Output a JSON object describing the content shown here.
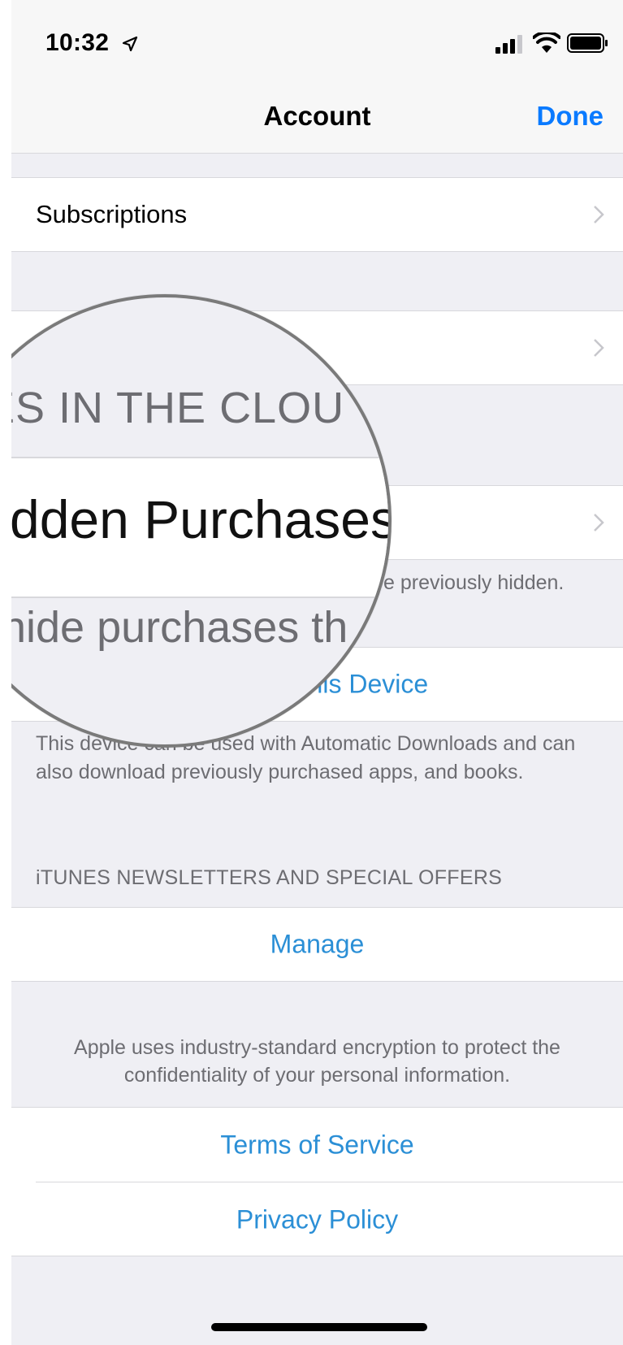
{
  "status_bar": {
    "time": "10:32"
  },
  "nav": {
    "title": "Account",
    "done_label": "Done"
  },
  "rows": {
    "subscriptions": "Subscriptions",
    "hidden_purchases_footer": "e previously hidden.",
    "this_device_link": "This Device",
    "device_footer": "This device can be used with Automatic Downloads and can also download previously purchased apps, and books.",
    "newsletters_header": "iTUNES NEWSLETTERS AND SPECIAL OFFERS",
    "manage_link": "Manage",
    "encryption_note": "Apple uses industry-standard encryption to protect the confidentiality of your personal information.",
    "terms_link": "Terms of Service",
    "privacy_link": "Privacy Policy"
  },
  "magnifier": {
    "header": "UNES IN THE CLOU",
    "cell_label": "dden Purchases",
    "footer": "hide purchases th"
  },
  "colors": {
    "accent": "#0a7aff",
    "link": "#2b8fd6",
    "background": "#efeff4"
  }
}
